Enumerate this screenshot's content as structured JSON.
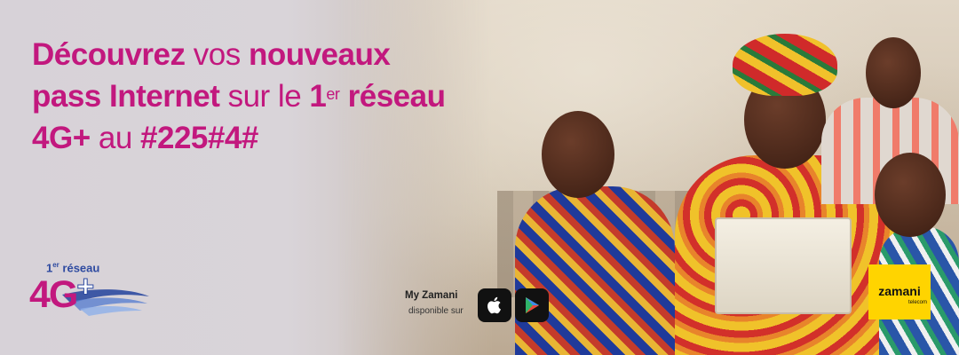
{
  "headline": {
    "l1_b1": "Découvrez",
    "l1_t": " vos ",
    "l1_b2": "nouveaux",
    "l2_b1": "pass Internet",
    "l2_t": " sur le ",
    "l2_b2a": "1",
    "l2_sup": "er",
    "l2_b2b": " réseau",
    "l3_b1": "4G+",
    "l3_t": " au ",
    "l3_b2": "#225#4#"
  },
  "network_logo": {
    "rank": "1",
    "rank_sup": "er",
    "label": " réseau",
    "tech": "4G",
    "plus": "+"
  },
  "app_promo": {
    "title": "My Zamani",
    "subtitle": "disponible sur",
    "stores": [
      "apple-icon",
      "google-play-icon"
    ]
  },
  "brand": {
    "name": "zamani",
    "tagline": "telecom"
  },
  "colors": {
    "primary": "#c2187e",
    "blue": "#2e4aa0",
    "brand_yellow": "#ffd400"
  }
}
